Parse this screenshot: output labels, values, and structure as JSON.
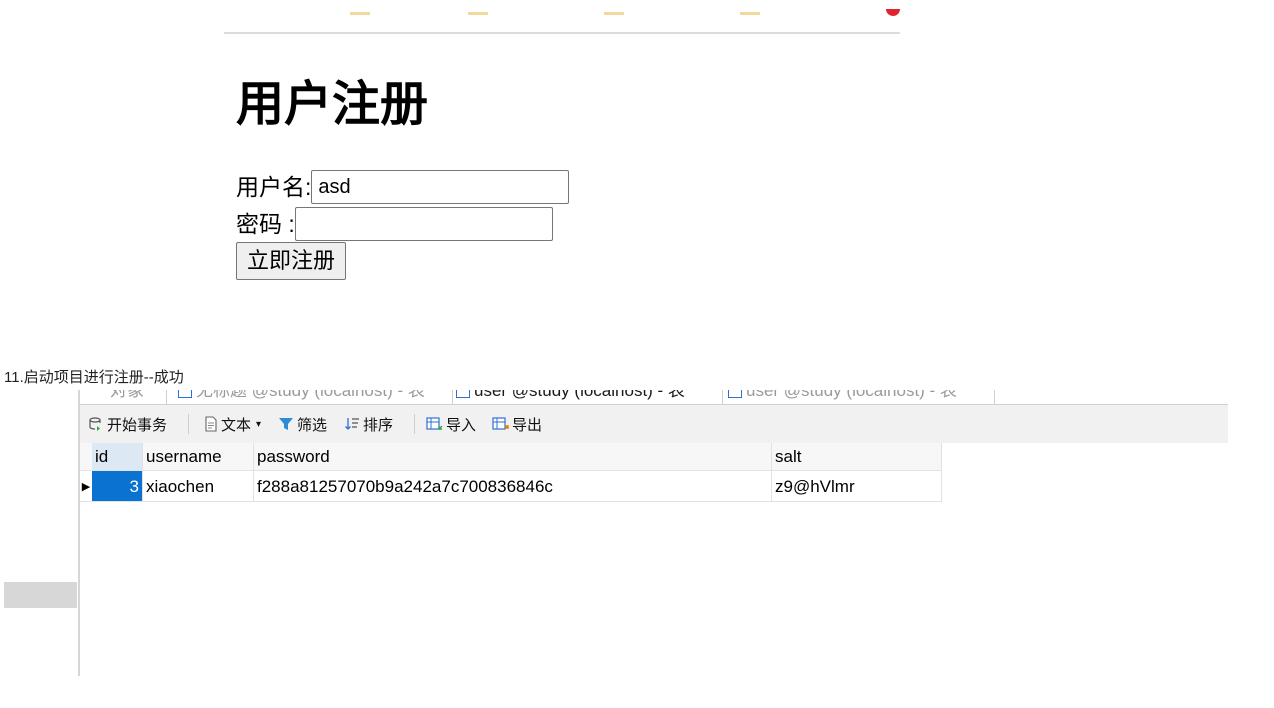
{
  "register_page": {
    "title": "用户注册",
    "username_label": "用户名:",
    "username_value": "asd",
    "password_label": "密码 :",
    "password_value": "",
    "submit_label": "立即注册"
  },
  "caption": "11.启动项目进行注册--成功",
  "db_tool": {
    "tabs": [
      "对象",
      "无标题 @study (localhost) - 表",
      "user @study (localhost) - 表",
      "user @study (localhost) - 表"
    ],
    "toolbar": {
      "begin_transaction": "开始事务",
      "text": "文本",
      "filter": "筛选",
      "sort": "排序",
      "import": "导入",
      "export": "导出"
    },
    "table": {
      "columns": [
        "id",
        "username",
        "password",
        "salt"
      ],
      "rows": [
        {
          "id": "3",
          "username": "xiaochen",
          "password": "f288a81257070b9a242a7c700836846c",
          "salt": "z9@hVlmr"
        }
      ]
    }
  }
}
